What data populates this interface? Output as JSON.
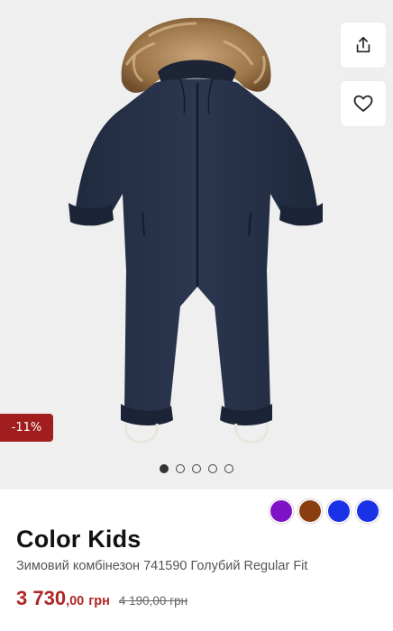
{
  "product": {
    "discount": "-11%",
    "brand": "Color Kids",
    "title": "Зимовий комбінезон 741590 Голубий Regular Fit",
    "price": {
      "main": "3 730",
      "fraction": ",00",
      "currency": "грн",
      "old": "4 190,00 грн"
    }
  },
  "gallery": {
    "image_count": 5,
    "active_index": 0
  },
  "actions": {
    "share_icon": "share-icon",
    "wishlist_icon": "heart-icon"
  },
  "colors": [
    {
      "hex": "#7d12c7"
    },
    {
      "hex": "#8a3e0f"
    },
    {
      "hex": "#1a32e6"
    },
    {
      "hex": "#1a32e6"
    }
  ],
  "theme": {
    "accent": "#b02626",
    "badge": "#a21e1e",
    "jacket": "#27324a"
  }
}
